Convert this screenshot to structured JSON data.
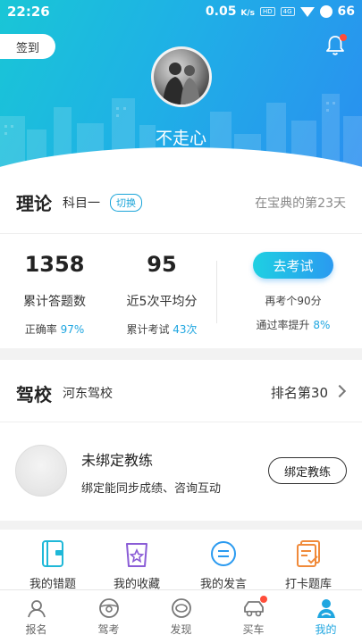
{
  "status_bar": {
    "time": "22:26",
    "speed": "0.05",
    "speed_unit": "K/s",
    "network_label": "4G",
    "battery": "66"
  },
  "header": {
    "signin_label": "签到",
    "username": "不走心"
  },
  "theory": {
    "title": "理论",
    "subject": "科目一",
    "switch_label": "切换",
    "days_text": "在宝典的第23天"
  },
  "stats": {
    "answered_count": "1358",
    "answered_label": "累计答题数",
    "accuracy_prefix": "正确率",
    "accuracy_value": "97%",
    "avg_score": "95",
    "avg_label": "近5次平均分",
    "exams_prefix": "累计考试",
    "exams_value": "43次",
    "exam_button": "去考试",
    "next_target": "再考个90分",
    "pass_rate_prefix": "通过率提升",
    "pass_rate_value": "8%"
  },
  "school": {
    "title": "驾校",
    "name": "河东驾校",
    "rank_text": "排名第30"
  },
  "coach": {
    "title": "未绑定教练",
    "desc": "绑定能同步成绩、咨询互动",
    "bind_button": "绑定教练"
  },
  "features": [
    {
      "label": "我的错题",
      "icon": "notebook-icon"
    },
    {
      "label": "我的收藏",
      "icon": "star-bag-icon"
    },
    {
      "label": "我的发言",
      "icon": "chat-icon"
    },
    {
      "label": "打卡题库",
      "icon": "checklist-icon"
    }
  ],
  "tabs": [
    {
      "label": "报名",
      "icon": "signup-icon"
    },
    {
      "label": "驾考",
      "icon": "steering-wheel-icon"
    },
    {
      "label": "发现",
      "icon": "discover-icon"
    },
    {
      "label": "买车",
      "icon": "car-icon"
    },
    {
      "label": "我的",
      "icon": "profile-icon"
    }
  ],
  "colors": {
    "accent": "#1fa6e0",
    "hero_start": "#19c6d6",
    "hero_end": "#2a8ff0",
    "badge_red": "#ff4d3a"
  }
}
